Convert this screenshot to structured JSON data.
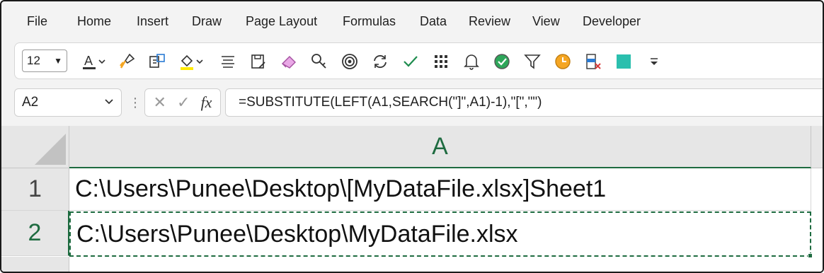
{
  "menu": [
    "File",
    "Home",
    "Insert",
    "Draw",
    "Page Layout",
    "Formulas",
    "Data",
    "Review",
    "View",
    "Developer"
  ],
  "toolbar": {
    "font_size": "12",
    "chevron": "⌄",
    "icons": [
      "font-color-icon",
      "format-painter-icon",
      "format-icon",
      "fill-color-icon",
      "align-icon",
      "save-icon",
      "eraser-icon",
      "search-key-icon",
      "target-icon",
      "refresh-icon",
      "check-icon",
      "grid-icon",
      "bell-icon",
      "check-circle-icon",
      "filter-icon",
      "clock-icon",
      "delete-column-icon",
      "fill-square-icon",
      "more-icon"
    ],
    "accent_teal": "#2bbfae",
    "accent_orange": "#f5a623",
    "accent_green": "#1e6b40",
    "highlight_yellow": "#ffea00"
  },
  "formula_bar": {
    "name_box": "A2",
    "cancel": "✕",
    "enter": "✓",
    "fx": "fx",
    "formula": "=SUBSTITUTE(LEFT(A1,SEARCH(\"]\",A1)-1),\"[\",\"\")"
  },
  "grid": {
    "column": "A",
    "rows": [
      {
        "label": "1",
        "value": "C:\\Users\\Punee\\Desktop\\[MyDataFile.xlsx]Sheet1"
      },
      {
        "label": "2",
        "value": "C:\\Users\\Punee\\Desktop\\MyDataFile.xlsx"
      }
    ]
  }
}
